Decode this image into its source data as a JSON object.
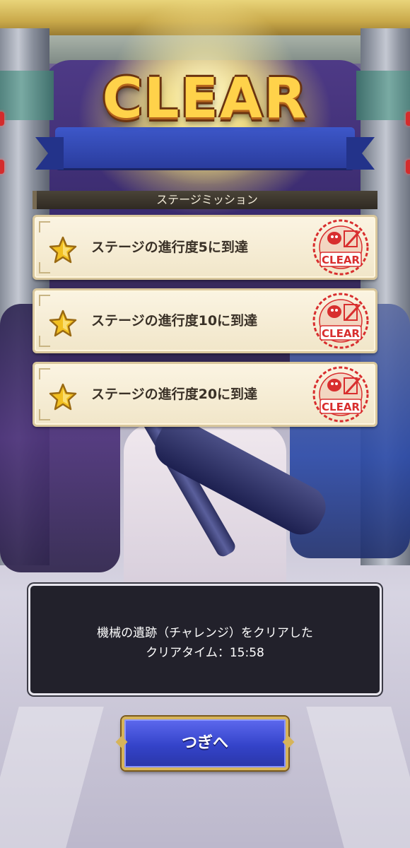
{
  "title": "CLEAR",
  "mission_header": "ステージミッション",
  "missions": [
    {
      "label": "ステージの進行度5に到達",
      "stamp": "CLEAR"
    },
    {
      "label": "ステージの進行度10に到達",
      "stamp": "CLEAR"
    },
    {
      "label": "ステージの進行度20に到達",
      "stamp": "CLEAR"
    }
  ],
  "result": {
    "line1": "機械の遺跡（チャレンジ）をクリアした",
    "line2": "クリアタイム：15:58"
  },
  "next_button": "つぎへ",
  "colors": {
    "title_gold": "#ffd24a",
    "button_blue": "#3443c9",
    "stamp_red": "#d82e2e",
    "star_gold": "#f2c021"
  },
  "icons": {
    "mission": "star-icon",
    "stamp": "clear-stamp-icon"
  }
}
